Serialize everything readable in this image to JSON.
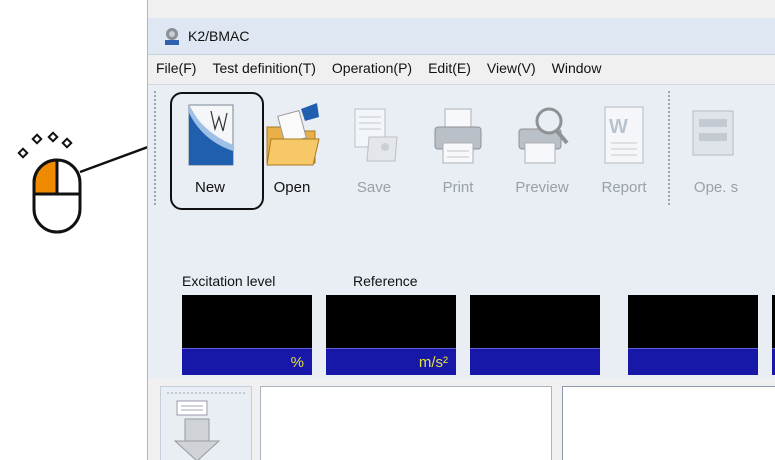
{
  "window": {
    "title": "K2/BMAC",
    "app_icon": "bmac-app-icon"
  },
  "menu": [
    "File(F)",
    "Test definition(T)",
    "Operation(P)",
    "Edit(E)",
    "View(V)",
    "Window"
  ],
  "toolbar": {
    "new": "New",
    "open": "Open",
    "save": "Save",
    "print": "Print",
    "preview": "Preview",
    "report": "Report",
    "ope": "Ope. s"
  },
  "meters": {
    "excitation_label": "Excitation level",
    "reference_label": "Reference",
    "unit_percent": "%",
    "unit_ms2": "m/s²"
  },
  "colors": {
    "meter_bg": "#000000",
    "meter_bar": "#1818a8",
    "meter_unit": "#e0e040",
    "mouse_button": "#f08a00"
  }
}
